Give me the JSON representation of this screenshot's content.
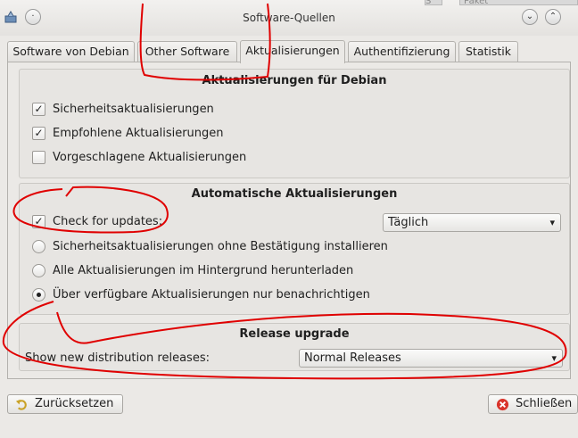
{
  "window": {
    "title": "Software-Quellen",
    "background_strip": [
      "S",
      "Paket"
    ]
  },
  "tabs": [
    {
      "label": "Software von Debian",
      "active": false
    },
    {
      "label": "Other Software",
      "active": false
    },
    {
      "label": "Aktualisierungen",
      "active": true
    },
    {
      "label": "Authentifizierung",
      "active": false
    },
    {
      "label": "Statistik",
      "active": false
    }
  ],
  "debian_updates": {
    "title": "Aktualisierungen für Debian",
    "options": [
      {
        "label": "Sicherheitsaktualisierungen",
        "checked": true
      },
      {
        "label": "Empfohlene Aktualisierungen",
        "checked": true
      },
      {
        "label": "Vorgeschlagene Aktualisierungen",
        "checked": false
      }
    ]
  },
  "auto_updates": {
    "title": "Automatische Aktualisierungen",
    "check_label": "Check for updates:",
    "check_checked": true,
    "interval": "Täglich",
    "radios": [
      {
        "label": "Sicherheitsaktualisierungen ohne Bestätigung installieren",
        "selected": false
      },
      {
        "label": "Alle Aktualisierungen im Hintergrund herunterladen",
        "selected": false
      },
      {
        "label": "Über verfügbare Aktualisierungen nur benachrichtigen",
        "selected": true
      }
    ]
  },
  "release_upgrade": {
    "title": "Release upgrade",
    "label": "Show new distribution releases:",
    "value": "Normal Releases"
  },
  "buttons": {
    "reset": "Zurücksetzen",
    "close": "Schließen"
  },
  "colors": {
    "annotation": "#e00000",
    "close_icon": "#d9342b",
    "reset_icon": "#c9a227"
  }
}
